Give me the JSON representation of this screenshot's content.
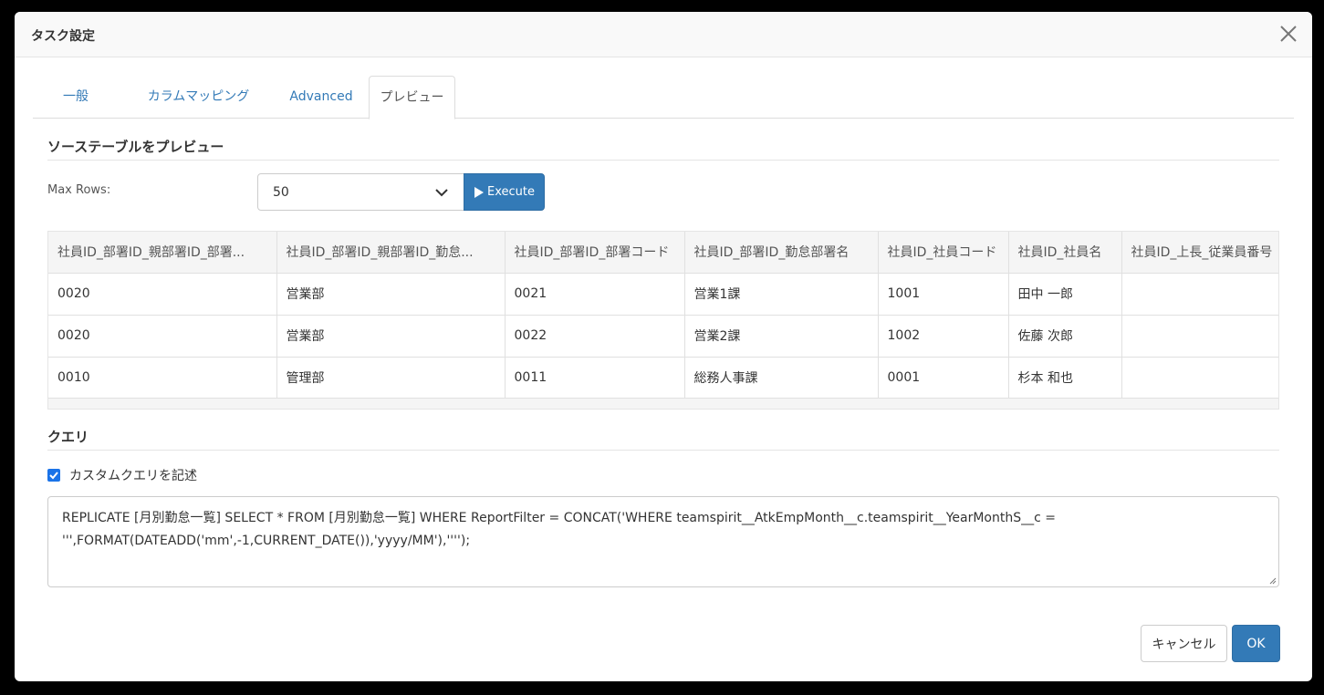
{
  "dialog": {
    "title": "タスク設定"
  },
  "tabs": [
    {
      "label": "一般"
    },
    {
      "label": "カラムマッピング"
    },
    {
      "label": "Advanced"
    },
    {
      "label": "プレビュー"
    }
  ],
  "preview": {
    "section_title": "ソーステーブルをプレビュー",
    "max_rows_label": "Max Rows:",
    "max_rows_value": "50",
    "execute_label": "Execute",
    "columns": [
      "社員ID_部署ID_親部署ID_部署...",
      "社員ID_部署ID_親部署ID_勤怠...",
      "社員ID_部署ID_部署コード",
      "社員ID_部署ID_勤怠部署名",
      "社員ID_社員コード",
      "社員ID_社員名",
      "社員ID_上長_従業員番号"
    ],
    "rows": [
      [
        "0020",
        "営業部",
        "0021",
        "営業1課",
        "1001",
        "田中 一郎",
        ""
      ],
      [
        "0020",
        "営業部",
        "0022",
        "営業2課",
        "1002",
        "佐藤 次郎",
        ""
      ],
      [
        "0010",
        "管理部",
        "0011",
        "総務人事課",
        "0001",
        "杉本 和也",
        ""
      ]
    ]
  },
  "query": {
    "section_title": "クエリ",
    "custom_query_label": "カスタムクエリを記述",
    "custom_query_checked": true,
    "text": "REPLICATE [月別勤怠一覧] SELECT * FROM [月別勤怠一覧] WHERE ReportFilter = CONCAT('WHERE teamspirit__AtkEmpMonth__c.teamspirit__YearMonthS__c = ''',FORMAT(DATEADD('mm',-1,CURRENT_DATE()),'yyyy/MM'),'''');"
  },
  "footer": {
    "cancel_label": "キャンセル",
    "ok_label": "OK"
  },
  "colors": {
    "primary": "#337ab7",
    "tab_link": "#337ab7",
    "checkbox": "#1a73e8"
  },
  "icons": [
    "close-icon",
    "chevron-down-icon",
    "play-icon",
    "checkmark-icon",
    "resize-grip-icon"
  ]
}
